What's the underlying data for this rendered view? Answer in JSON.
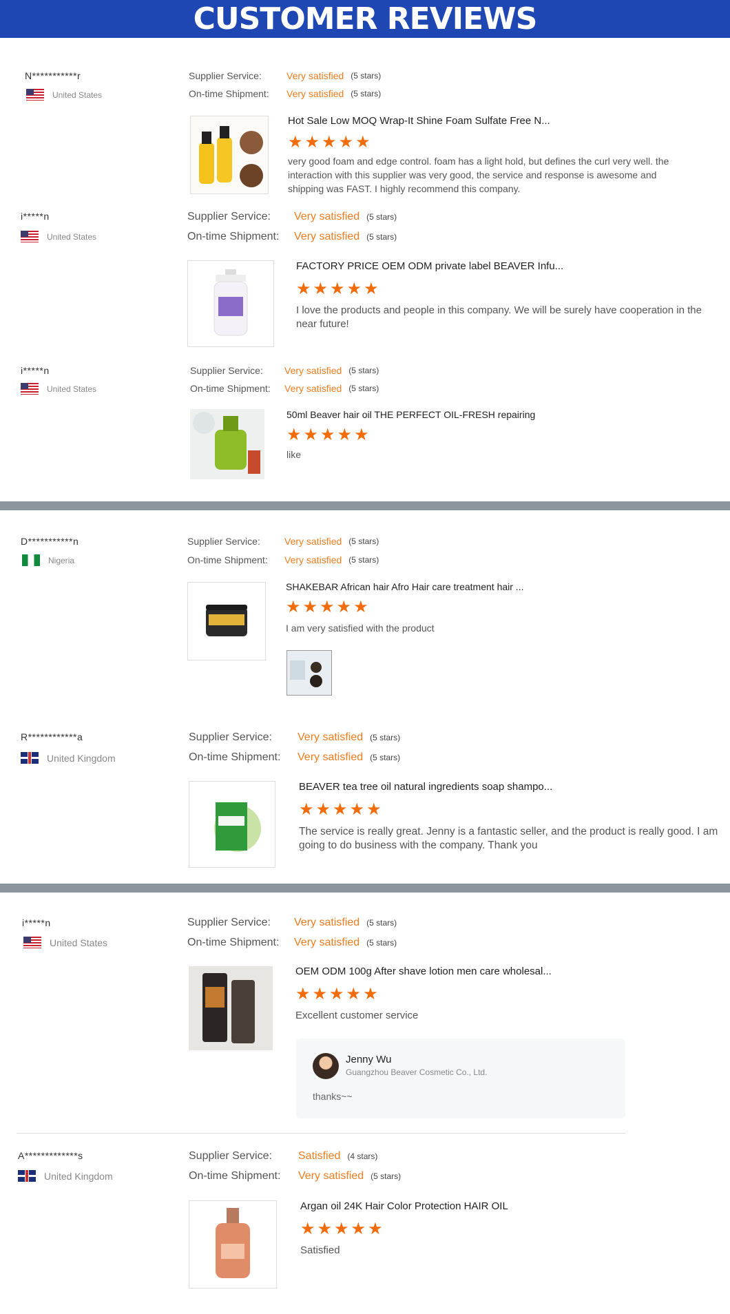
{
  "banner": {
    "title": "CUSTOMER REVIEWS"
  },
  "labels": {
    "supplier_service": "Supplier Service:",
    "ontime_shipment": "On-time Shipment:"
  },
  "colors": {
    "banner": "#1f47b4",
    "accent": "#f07c1e",
    "star": "#f36c0c",
    "separator": "#8c959e"
  },
  "reviews": [
    {
      "user": "N***********r",
      "country": "United States",
      "flag": "us",
      "supplier_value": "Very satisfied",
      "supplier_stars": "(5 stars)",
      "shipment_value": "Very satisfied",
      "shipment_stars": "(5 stars)",
      "product_title": "Hot Sale Low MOQ Wrap-It Shine Foam Sulfate Free N...",
      "rating": 5,
      "text": "very good foam and edge control. foam has a light hold, but defines the curl very well. the interaction with this supplier was very good, the service and response is awesome and shipping was FAST. I highly recommend this company."
    },
    {
      "user": "i*****n",
      "country": "United States",
      "flag": "us",
      "supplier_value": "Very satisfied",
      "supplier_stars": "(5 stars)",
      "shipment_value": "Very satisfied",
      "shipment_stars": "(5 stars)",
      "product_title": "FACTORY PRICE OEM ODM private label BEAVER Infu...",
      "rating": 5,
      "text": "I love the products and people in this company. We will be surely have cooperation in the near future!"
    },
    {
      "user": "i*****n",
      "country": "United States",
      "flag": "us",
      "supplier_value": "Very satisfied",
      "supplier_stars": "(5 stars)",
      "shipment_value": "Very satisfied",
      "shipment_stars": "(5 stars)",
      "product_title": "50ml Beaver hair oil THE PERFECT OIL-FRESH repairing",
      "rating": 5,
      "text": "like"
    },
    {
      "user": "D***********n",
      "country": "Nigeria",
      "flag": "ng",
      "supplier_value": "Very satisfied",
      "supplier_stars": "(5 stars)",
      "shipment_value": "Very satisfied",
      "shipment_stars": "(5 stars)",
      "product_title": "SHAKEBAR African hair Afro Hair care treatment hair ...",
      "rating": 5,
      "text": "I am very satisfied with the product"
    },
    {
      "user": "R************a",
      "country": "United Kingdom",
      "flag": "uk",
      "supplier_value": "Very satisfied",
      "supplier_stars": "(5 stars)",
      "shipment_value": "Very satisfied",
      "shipment_stars": "(5 stars)",
      "product_title": "BEAVER tea tree oil natural ingredients soap shampo...",
      "rating": 5,
      "text": "The service is really great. Jenny is a fantastic seller, and the product is really good. I am going to do business with the company. Thank you"
    },
    {
      "user": "i*****n",
      "country": "United States",
      "flag": "us",
      "supplier_value": "Very satisfied",
      "supplier_stars": "(5 stars)",
      "shipment_value": "Very satisfied",
      "shipment_stars": "(5 stars)",
      "product_title": "OEM ODM 100g After shave lotion men care wholesal...",
      "rating": 5,
      "text": "Excellent customer service",
      "reply": {
        "name": "Jenny Wu",
        "company": "Guangzhou Beaver Cosmetic Co., Ltd.",
        "text": "thanks~~"
      }
    },
    {
      "user": "A*************s",
      "country": "United Kingdom",
      "flag": "uk",
      "supplier_value": "Satisfied",
      "supplier_stars": "(4 stars)",
      "shipment_value": "Very satisfied",
      "shipment_stars": "(5 stars)",
      "product_title": "Argan oil 24K Hair Color Protection HAIR OIL",
      "rating": 5,
      "text": "Satisfied"
    }
  ]
}
